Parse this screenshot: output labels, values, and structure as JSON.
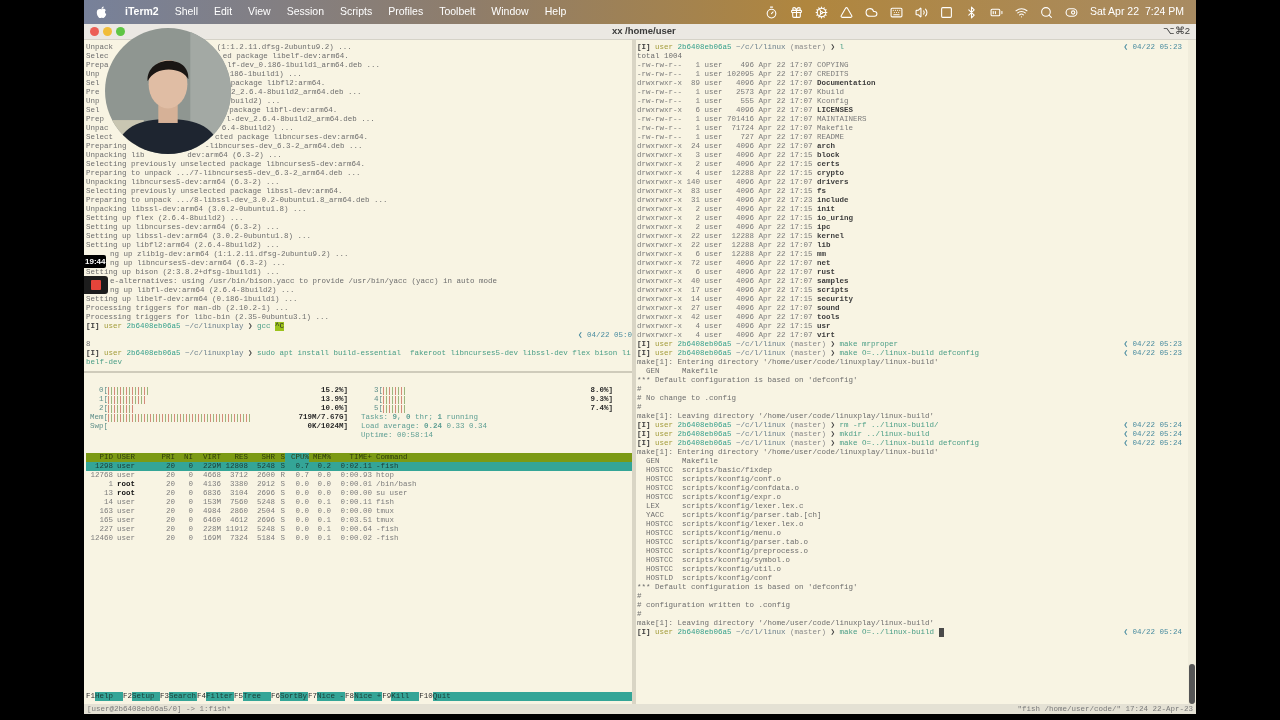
{
  "menu_bar": {
    "app": "iTerm2",
    "menus": [
      "Shell",
      "Edit",
      "View",
      "Session",
      "Scripts",
      "Profiles",
      "Toolbelt",
      "Window",
      "Help"
    ],
    "clock": "Sat Apr 22  7:24 PM"
  },
  "window": {
    "title": "xx /home/user",
    "shortcut": "⌥⌘2"
  },
  "recorder": {
    "timer": "19:44"
  },
  "left_pane": {
    "lines": [
      {
        "kind": "split",
        "left": "Unpack",
        "right": "(1:1.2.11.dfsg-2ubuntu9.2) ..."
      },
      {
        "kind": "split",
        "left": "Selec",
        "right": "ed package libelf-dev:arm64."
      },
      {
        "kind": "split",
        "left": "Prepa",
        "right": "lf-dev_0.186-1build1_arm64.deb ..."
      },
      {
        "kind": "split",
        "left": "Unp",
        "right": "186-1build1) ..."
      },
      {
        "kind": "split",
        "left": "Sel",
        "right": "package libfl2:arm64."
      },
      {
        "kind": "split",
        "left": "Pre",
        "right": "2_2.6.4-8build2_arm64.deb ..."
      },
      {
        "kind": "split",
        "left": "Unp",
        "right": "build2) ..."
      },
      {
        "kind": "split",
        "left": "Sel",
        "right": "package libfl-dev:arm64."
      },
      {
        "kind": "split",
        "left": "Prep",
        "right": "l-dev_2.6.4-8build2_arm64.deb ..."
      },
      {
        "kind": "split",
        "left": "Unpac",
        "right": "6.4-8build2) ..."
      },
      {
        "kind": "split",
        "left": "Select",
        "right": "cted package libncurses-dev:arm64."
      },
      {
        "kind": "split",
        "left": "Preparing",
        "right": "-libncurses-dev_6.3-2_arm64.deb ..."
      },
      {
        "kind": "split",
        "left": "Unpacking lib",
        "right": "dev:arm64 (6.3-2) ..."
      },
      {
        "kind": "out",
        "text": "Selecting previously unselected package libncurses5-dev:arm64."
      },
      {
        "kind": "out",
        "text": "Preparing to unpack .../7-libncurses5-dev_6.3-2_arm64.deb ..."
      },
      {
        "kind": "out",
        "text": "Unpacking libncurses5-dev:arm64 (6.3-2) ..."
      },
      {
        "kind": "out",
        "text": "Selecting previously unselected package libssl-dev:arm64."
      },
      {
        "kind": "out",
        "text": "Preparing to unpack .../8-libssl-dev_3.0.2-0ubuntu1.8_arm64.deb ..."
      },
      {
        "kind": "out",
        "text": "Unpacking libssl-dev:arm64 (3.0.2-0ubuntu1.8) ..."
      },
      {
        "kind": "out",
        "text": "Setting up flex (2.6.4-8build2) ..."
      },
      {
        "kind": "out",
        "text": "Setting up libncurses-dev:arm64 (6.3-2) ..."
      },
      {
        "kind": "out",
        "text": "Setting up libssl-dev:arm64 (3.0.2-0ubuntu1.8) ..."
      },
      {
        "kind": "out",
        "text": "Setting up libfl2:arm64 (2.6.4-8build2) ..."
      },
      {
        "kind": "split",
        "right": "ng up zlib1g-dev:arm64 (1:1.2.11.dfsg-2ubuntu9.2) ..."
      },
      {
        "kind": "split",
        "right": "ng up libncurses5-dev:arm64 (6.3-2) ..."
      },
      {
        "kind": "out",
        "text": "Setting up bison (2:3.8.2+dfsg-1build1) ..."
      },
      {
        "kind": "split",
        "right": "e-alternatives: using /usr/bin/bison.yacc to provide /usr/bin/yacc (yacc) in auto mode"
      },
      {
        "kind": "split",
        "right": "ng up libfl-dev:arm64 (2.6.4-8build2) ..."
      },
      {
        "kind": "out",
        "text": "Setting up libelf-dev:arm64 (0.186-1build1) ..."
      },
      {
        "kind": "out",
        "text": "Processing triggers for man-db (2.10.2-1) ..."
      },
      {
        "kind": "out",
        "text": "Processing triggers for libc-bin (2.35-0ubuntu3.1) ..."
      },
      {
        "kind": "prompt",
        "mode": "[I]",
        "user": "user",
        "host": "2b6408eb06a5",
        "path": "~/c/linuxplay",
        "sign": "❯",
        "command": "gcc",
        "interrupt": "^C",
        "cursor": false
      },
      {
        "kind": "time",
        "text": "❮ 04/22 05:0"
      },
      {
        "kind": "out",
        "text": "8"
      },
      {
        "kind": "prompt",
        "mode": "[I]",
        "user": "user",
        "host": "2b6408eb06a5",
        "path": "~/c/linuxplay",
        "sign": "❯",
        "command": "sudo apt install build-essential  fakeroot libncurses5-dev libssl-dev flex bison li",
        "cursor": false
      },
      {
        "kind": "cont",
        "text": "belf-dev"
      }
    ]
  },
  "htop": {
    "meters_left": [
      {
        "label": "0[",
        "reading": "15.2%]"
      },
      {
        "label": "1[",
        "reading": "13.9%]"
      },
      {
        "label": "2[",
        "reading": "10.0%]"
      },
      {
        "label": "Mem[",
        "reading": "719M/7.67G]"
      },
      {
        "label": "Swp[",
        "reading": "0K/1024M]"
      }
    ],
    "meters_right": [
      {
        "label": "3[",
        "reading": "8.0%]"
      },
      {
        "label": "4[",
        "reading": "9.3%]"
      },
      {
        "label": "5[",
        "reading": "7.4%]"
      }
    ],
    "tasks": "Tasks: **9**, **0** thr; **1** running",
    "load": "Load average: **0.24** 0.33 0.34",
    "uptime": "Uptime: 00:58:14",
    "columns": [
      {
        "label": "PID",
        "selected": false
      },
      {
        "label": "USER",
        "selected": false
      },
      {
        "label": "PRI",
        "selected": false
      },
      {
        "label": "NI",
        "selected": false
      },
      {
        "label": "VIRT",
        "selected": false
      },
      {
        "label": "RES",
        "selected": false
      },
      {
        "label": "SHR",
        "selected": false
      },
      {
        "label": "S",
        "selected": false
      },
      {
        "label": "CPU%",
        "selected": true
      },
      {
        "label": "MEM%",
        "selected": false
      },
      {
        "label": "TIME+",
        "selected": false
      },
      {
        "label": "Command",
        "selected": false
      }
    ],
    "processes": [
      {
        "selected": true,
        "bold_user": false,
        "cells": [
          "1298",
          "user",
          "20",
          "0",
          "229M",
          "12808",
          "5248",
          "S",
          "0.7",
          "0.2",
          "0:02.11",
          "-fish"
        ]
      },
      {
        "selected": false,
        "bold_user": false,
        "cells": [
          "12768",
          "user",
          "20",
          "0",
          "4668",
          "3712",
          "2600",
          "R",
          "0.7",
          "0.0",
          "0:00.93",
          "htop"
        ]
      },
      {
        "selected": false,
        "bold_user": true,
        "cells": [
          "1",
          "root",
          "20",
          "0",
          "4136",
          "3380",
          "2912",
          "S",
          "0.0",
          "0.0",
          "0:00.01",
          "/bin/bash"
        ]
      },
      {
        "selected": false,
        "bold_user": true,
        "cells": [
          "13",
          "root",
          "20",
          "0",
          "6836",
          "3104",
          "2696",
          "S",
          "0.0",
          "0.0",
          "0:00.00",
          "su user"
        ]
      },
      {
        "selected": false,
        "bold_user": false,
        "cells": [
          "14",
          "user",
          "20",
          "0",
          "153M",
          "7560",
          "5248",
          "S",
          "0.0",
          "0.1",
          "0:00.11",
          "fish"
        ]
      },
      {
        "selected": false,
        "bold_user": false,
        "cells": [
          "163",
          "user",
          "20",
          "0",
          "4984",
          "2860",
          "2504",
          "S",
          "0.0",
          "0.0",
          "0:00.00",
          "tmux"
        ]
      },
      {
        "selected": false,
        "bold_user": false,
        "cells": [
          "165",
          "user",
          "20",
          "0",
          "6460",
          "4612",
          "2696",
          "S",
          "0.0",
          "0.1",
          "0:03.51",
          "tmux"
        ]
      },
      {
        "selected": false,
        "bold_user": false,
        "cells": [
          "227",
          "user",
          "20",
          "0",
          "228M",
          "11912",
          "5248",
          "S",
          "0.0",
          "0.1",
          "0:00.64",
          "-fish"
        ]
      },
      {
        "selected": false,
        "bold_user": false,
        "cells": [
          "12460",
          "user",
          "20",
          "0",
          "169M",
          "7324",
          "5184",
          "S",
          "0.0",
          "0.1",
          "0:00.02",
          "-fish"
        ]
      }
    ],
    "function_keys": [
      {
        "key": "F1",
        "label": "Help"
      },
      {
        "key": "F2",
        "label": "Setup"
      },
      {
        "key": "F3",
        "label": "Search"
      },
      {
        "key": "F4",
        "label": "Filter"
      },
      {
        "key": "F5",
        "label": "Tree"
      },
      {
        "key": "F6",
        "label": "SortBy"
      },
      {
        "key": "F7",
        "label": "Nice -"
      },
      {
        "key": "F8",
        "label": "Nice +"
      },
      {
        "key": "F9",
        "label": "Kill"
      },
      {
        "key": "F10",
        "label": "Quit"
      }
    ]
  },
  "right_pane": {
    "lines": [
      {
        "kind": "prompt",
        "mode": "[I]",
        "user": "user",
        "host": "2b6408eb06a5",
        "path": "~/c/l/linux",
        "branch": "(master)",
        "sign": "❯",
        "command": "l",
        "time": "❮ 04/22 05:23",
        "cursor": false
      },
      {
        "kind": "out",
        "text": "total 1004"
      },
      {
        "kind": "ls",
        "is_dir": false,
        "meta": "-rw-rw-r--   1 user    496 Apr 22 17:07",
        "name": "COPYING"
      },
      {
        "kind": "ls",
        "is_dir": false,
        "meta": "-rw-rw-r--   1 user 102095 Apr 22 17:07",
        "name": "CREDITS"
      },
      {
        "kind": "ls",
        "is_dir": true,
        "meta": "drwxrwxr-x  89 user   4096 Apr 22 17:07",
        "name": "Documentation"
      },
      {
        "kind": "ls",
        "is_dir": false,
        "meta": "-rw-rw-r--   1 user   2573 Apr 22 17:07",
        "name": "Kbuild"
      },
      {
        "kind": "ls",
        "is_dir": false,
        "meta": "-rw-rw-r--   1 user    555 Apr 22 17:07",
        "name": "Kconfig"
      },
      {
        "kind": "ls",
        "is_dir": true,
        "meta": "drwxrwxr-x   6 user   4096 Apr 22 17:07",
        "name": "LICENSES"
      },
      {
        "kind": "ls",
        "is_dir": false,
        "meta": "-rw-rw-r--   1 user 701416 Apr 22 17:07",
        "name": "MAINTAINERS"
      },
      {
        "kind": "ls",
        "is_dir": false,
        "meta": "-rw-rw-r--   1 user  71724 Apr 22 17:07",
        "name": "Makefile"
      },
      {
        "kind": "ls",
        "is_dir": false,
        "meta": "-rw-rw-r--   1 user    727 Apr 22 17:07",
        "name": "README"
      },
      {
        "kind": "ls",
        "is_dir": true,
        "meta": "drwxrwxr-x  24 user   4096 Apr 22 17:07",
        "name": "arch"
      },
      {
        "kind": "ls",
        "is_dir": true,
        "meta": "drwxrwxr-x   3 user   4096 Apr 22 17:15",
        "name": "block"
      },
      {
        "kind": "ls",
        "is_dir": true,
        "meta": "drwxrwxr-x   2 user   4096 Apr 22 17:15",
        "name": "certs"
      },
      {
        "kind": "ls",
        "is_dir": true,
        "meta": "drwxrwxr-x   4 user  12288 Apr 22 17:15",
        "name": "crypto"
      },
      {
        "kind": "ls",
        "is_dir": true,
        "meta": "drwxrwxr-x 140 user   4096 Apr 22 17:07",
        "name": "drivers"
      },
      {
        "kind": "ls",
        "is_dir": true,
        "meta": "drwxrwxr-x  83 user   4096 Apr 22 17:15",
        "name": "fs"
      },
      {
        "kind": "ls",
        "is_dir": true,
        "meta": "drwxrwxr-x  31 user   4096 Apr 22 17:23",
        "name": "include"
      },
      {
        "kind": "ls",
        "is_dir": true,
        "meta": "drwxrwxr-x   2 user   4096 Apr 22 17:15",
        "name": "init"
      },
      {
        "kind": "ls",
        "is_dir": true,
        "meta": "drwxrwxr-x   2 user   4096 Apr 22 17:15",
        "name": "io_uring"
      },
      {
        "kind": "ls",
        "is_dir": true,
        "meta": "drwxrwxr-x   2 user   4096 Apr 22 17:15",
        "name": "ipc"
      },
      {
        "kind": "ls",
        "is_dir": true,
        "meta": "drwxrwxr-x  22 user  12288 Apr 22 17:15",
        "name": "kernel"
      },
      {
        "kind": "ls",
        "is_dir": true,
        "meta": "drwxrwxr-x  22 user  12288 Apr 22 17:07",
        "name": "lib"
      },
      {
        "kind": "ls",
        "is_dir": true,
        "meta": "drwxrwxr-x   6 user  12288 Apr 22 17:15",
        "name": "mm"
      },
      {
        "kind": "ls",
        "is_dir": true,
        "meta": "drwxrwxr-x  72 user   4096 Apr 22 17:07",
        "name": "net"
      },
      {
        "kind": "ls",
        "is_dir": true,
        "meta": "drwxrwxr-x   6 user   4096 Apr 22 17:07",
        "name": "rust"
      },
      {
        "kind": "ls",
        "is_dir": true,
        "meta": "drwxrwxr-x  40 user   4096 Apr 22 17:07",
        "name": "samples"
      },
      {
        "kind": "ls",
        "is_dir": true,
        "meta": "drwxrwxr-x  17 user   4096 Apr 22 17:15",
        "name": "scripts"
      },
      {
        "kind": "ls",
        "is_dir": true,
        "meta": "drwxrwxr-x  14 user   4096 Apr 22 17:15",
        "name": "security"
      },
      {
        "kind": "ls",
        "is_dir": true,
        "meta": "drwxrwxr-x  27 user   4096 Apr 22 17:07",
        "name": "sound"
      },
      {
        "kind": "ls",
        "is_dir": true,
        "meta": "drwxrwxr-x  42 user   4096 Apr 22 17:07",
        "name": "tools"
      },
      {
        "kind": "ls",
        "is_dir": true,
        "meta": "drwxrwxr-x   4 user   4096 Apr 22 17:15",
        "name": "usr"
      },
      {
        "kind": "ls",
        "is_dir": true,
        "meta": "drwxrwxr-x   4 user   4096 Apr 22 17:07",
        "name": "virt"
      },
      {
        "kind": "prompt",
        "mode": "[I]",
        "user": "user",
        "host": "2b6408eb06a5",
        "path": "~/c/l/linux",
        "branch": "(master)",
        "sign": "❯",
        "command": "make mrproper",
        "time": "❮ 04/22 05:23",
        "cursor": false
      },
      {
        "kind": "prompt",
        "mode": "[I]",
        "user": "user",
        "host": "2b6408eb06a5",
        "path": "~/c/l/linux",
        "branch": "(master)",
        "sign": "❯",
        "command": "make O=../linux-build defconfig",
        "time": "❮ 04/22 05:23",
        "cursor": false
      },
      {
        "kind": "out",
        "text": "make[1]: Entering directory '/home/user/code/linuxplay/linux-build'"
      },
      {
        "kind": "out",
        "text": "  GEN     Makefile"
      },
      {
        "kind": "out",
        "text": "*** Default configuration is based on 'defconfig'"
      },
      {
        "kind": "out",
        "text": "#"
      },
      {
        "kind": "out",
        "text": "# No change to .config"
      },
      {
        "kind": "out",
        "text": "#"
      },
      {
        "kind": "out",
        "text": "make[1]: Leaving directory '/home/user/code/linuxplay/linux-build'"
      },
      {
        "kind": "prompt",
        "mode": "[I]",
        "user": "user",
        "host": "2b6408eb06a5",
        "path": "~/c/l/linux",
        "branch": "(master)",
        "sign": "❯",
        "command": "rm -rf ../linux-build/",
        "time": "❮ 04/22 05:24",
        "cursor": false
      },
      {
        "kind": "prompt",
        "mode": "[I]",
        "user": "user",
        "host": "2b6408eb06a5",
        "path": "~/c/l/linux",
        "branch": "(master)",
        "sign": "❯",
        "command": "mkdir ../linux-build",
        "time": "❮ 04/22 05:24",
        "cursor": false
      },
      {
        "kind": "prompt",
        "mode": "[I]",
        "user": "user",
        "host": "2b6408eb06a5",
        "path": "~/c/l/linux",
        "branch": "(master)",
        "sign": "❯",
        "command": "make O=../linux-build defconfig",
        "time": "❮ 04/22 05:24",
        "cursor": false
      },
      {
        "kind": "out",
        "text": "make[1]: Entering directory '/home/user/code/linuxplay/linux-build'"
      },
      {
        "kind": "out",
        "text": "  GEN     Makefile"
      },
      {
        "kind": "out",
        "text": "  HOSTCC  scripts/basic/fixdep"
      },
      {
        "kind": "out",
        "text": "  HOSTCC  scripts/kconfig/conf.o"
      },
      {
        "kind": "out",
        "text": "  HOSTCC  scripts/kconfig/confdata.o"
      },
      {
        "kind": "out",
        "text": "  HOSTCC  scripts/kconfig/expr.o"
      },
      {
        "kind": "out",
        "text": "  LEX     scripts/kconfig/lexer.lex.c"
      },
      {
        "kind": "out",
        "text": "  YACC    scripts/kconfig/parser.tab.[ch]"
      },
      {
        "kind": "out",
        "text": "  HOSTCC  scripts/kconfig/lexer.lex.o"
      },
      {
        "kind": "out",
        "text": "  HOSTCC  scripts/kconfig/menu.o"
      },
      {
        "kind": "out",
        "text": "  HOSTCC  scripts/kconfig/parser.tab.o"
      },
      {
        "kind": "out",
        "text": "  HOSTCC  scripts/kconfig/preprocess.o"
      },
      {
        "kind": "out",
        "text": "  HOSTCC  scripts/kconfig/symbol.o"
      },
      {
        "kind": "out",
        "text": "  HOSTCC  scripts/kconfig/util.o"
      },
      {
        "kind": "out",
        "text": "  HOSTLD  scripts/kconfig/conf"
      },
      {
        "kind": "out",
        "text": "*** Default configuration is based on 'defconfig'"
      },
      {
        "kind": "out",
        "text": "#"
      },
      {
        "kind": "out",
        "text": "# configuration written to .config"
      },
      {
        "kind": "out",
        "text": "#"
      },
      {
        "kind": "out",
        "text": "make[1]: Leaving directory '/home/user/code/linuxplay/linux-build'"
      },
      {
        "kind": "prompt",
        "mode": "[I]",
        "user": "user",
        "host": "2b6408eb06a5",
        "path": "~/c/l/linux",
        "branch": "(master)",
        "sign": "❯",
        "command": "make O=../linux-build",
        "time": "❮ 04/22 05:24",
        "cursor": true
      }
    ]
  },
  "status_bar": {
    "left": "[user@2b6408eb06a5/0] -> 1:fish*",
    "right": "\"fish /home/user/code/\" 17:24 22-Apr-23"
  }
}
